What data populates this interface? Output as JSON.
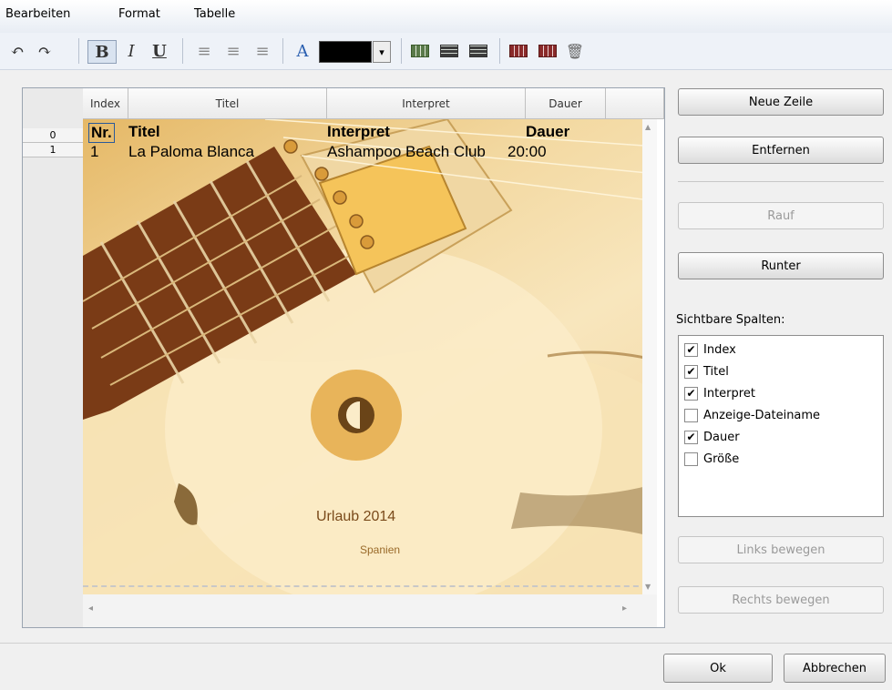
{
  "menu": {
    "items": [
      "Bearbeiten",
      "Format",
      "Tabelle"
    ]
  },
  "toolbar": {
    "undo": "↶",
    "redo": "↷",
    "bold": "B",
    "italic": "I",
    "underline": "U",
    "align_left": "≡",
    "align_center": "≡",
    "align_right": "≡",
    "font_color": "A",
    "color_value": "#000000",
    "dropdown": "▾",
    "delete": "🗑"
  },
  "table": {
    "columns": [
      "Index",
      "Titel",
      "Interpret",
      "Dauer"
    ],
    "row_numbers": [
      "0",
      "1"
    ],
    "rows": [
      [
        "Nr.",
        "Titel",
        "Interpret",
        "Dauer"
      ],
      [
        "1",
        "La Paloma Blanca",
        "Ashampoo Beach Club",
        "20:00"
      ]
    ]
  },
  "cover": {
    "title": "Urlaub 2014",
    "subtitle": "Spanien"
  },
  "buttons": {
    "new_row": "Neue Zeile",
    "remove": "Entfernen",
    "up": "Rauf",
    "down": "Runter",
    "move_left": "Links bewegen",
    "move_right": "Rechts bewegen",
    "ok": "Ok",
    "cancel": "Abbrechen"
  },
  "visible_columns": {
    "label": "Sichtbare Spalten:",
    "items": [
      {
        "label": "Index",
        "checked": true,
        "mark": "✔"
      },
      {
        "label": "Titel",
        "checked": true,
        "mark": "✔"
      },
      {
        "label": "Interpret",
        "checked": true,
        "mark": "✔"
      },
      {
        "label": "Anzeige-Dateiname",
        "checked": false,
        "mark": ""
      },
      {
        "label": "Dauer",
        "checked": true,
        "mark": "✔"
      },
      {
        "label": "Größe",
        "checked": false,
        "mark": ""
      }
    ]
  },
  "scroll": {
    "up": "▲",
    "down": "▼",
    "left": "◂",
    "right": "▸"
  },
  "colors": {
    "accent": "#3a6fb0",
    "fretboard": "#7a3b16",
    "pickguard": "#f5c45a"
  }
}
